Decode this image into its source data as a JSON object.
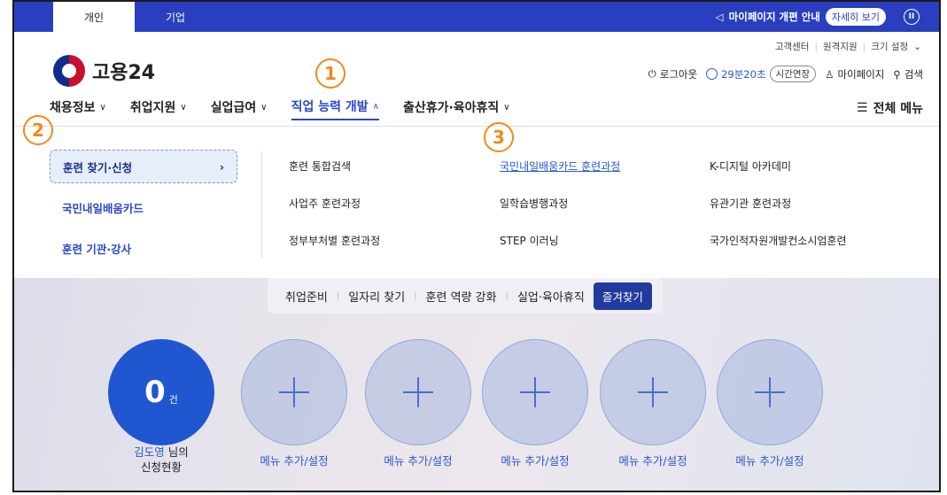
{
  "topbar": {
    "tab_personal": "개인",
    "tab_company": "기업",
    "notice_text": "마이페이지 개편 안내",
    "notice_more": "자세히 보기",
    "pause_label": "II",
    "notice_icon": "megaphone-icon"
  },
  "utility": {
    "customer_center": "고객센터",
    "remote_support": "원격지원",
    "font_size": "크기 설정"
  },
  "logo": {
    "text": "고용24"
  },
  "header": {
    "logout": "로그아웃",
    "timer": "29분20초",
    "extend": "시간연장",
    "mypage": "마이페이지",
    "search": "검색"
  },
  "nav": {
    "items": [
      {
        "label": "채용정보"
      },
      {
        "label": "취업지원"
      },
      {
        "label": "실업급여"
      },
      {
        "label": "직업 능력 개발"
      },
      {
        "label": "출산휴가·육아휴직"
      }
    ],
    "all_menu": "전체 메뉴"
  },
  "mega": {
    "side": [
      {
        "label": "훈련 찾기·신청"
      },
      {
        "label": "국민내일배움카드"
      },
      {
        "label": "훈련 기관·강사"
      }
    ],
    "col1": [
      "훈련 통합검색",
      "사업주 훈련과정",
      "정부부처별 훈련과정"
    ],
    "col2": [
      "국민내일배움카드 훈련과정",
      "일학습병행과정",
      "STEP 이러닝"
    ],
    "col3": [
      "K-디지털 아카데미",
      "유관기관 훈련과정",
      "국가인적자원개발컨소시엄훈련"
    ]
  },
  "quick": {
    "items": [
      "취업준비",
      "일자리 찾기",
      "훈련 역량 강화",
      "실업·육아휴직"
    ],
    "favorite": "즐겨찾기"
  },
  "summary": {
    "count": "0",
    "unit": "건",
    "user_name": "김도영",
    "user_suffix": "님의",
    "user_line2": "신청현황",
    "add_label": "메뉴 추가/설정"
  },
  "badges": [
    "1",
    "2",
    "3"
  ],
  "colors": {
    "primary": "#2a3fbf",
    "accent_orange": "#f08a1c",
    "count_circle": "#2156d1"
  }
}
